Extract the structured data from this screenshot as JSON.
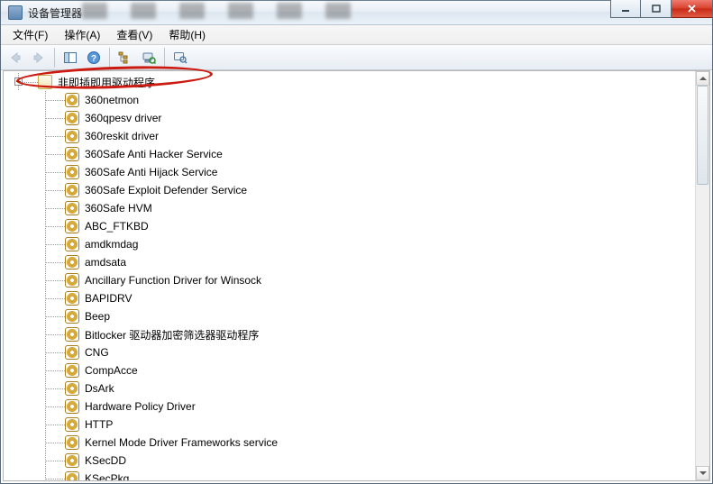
{
  "window": {
    "title": "设备管理器"
  },
  "menu": {
    "file": "文件(F)",
    "action": "操作(A)",
    "view": "查看(V)",
    "help": "帮助(H)"
  },
  "tree": {
    "category": {
      "label": "非即插即用驱动程序"
    },
    "items": [
      "360netmon",
      "360qpesv driver",
      "360reskit driver",
      "360Safe Anti Hacker Service",
      "360Safe Anti Hijack Service",
      "360Safe Exploit Defender Service",
      "360Safe HVM",
      "ABC_FTKBD",
      "amdkmdag",
      "amdsata",
      "Ancillary Function Driver for Winsock",
      "BAPIDRV",
      "Beep",
      "Bitlocker 驱动器加密筛选器驱动程序",
      "CNG",
      "CompAcce",
      "DsArk",
      "Hardware Policy Driver",
      "HTTP",
      "Kernel Mode Driver Frameworks service",
      "KSecDD",
      "KSecPkg"
    ]
  },
  "win_controls": {
    "min": "–",
    "max": "□",
    "close": "✕"
  }
}
